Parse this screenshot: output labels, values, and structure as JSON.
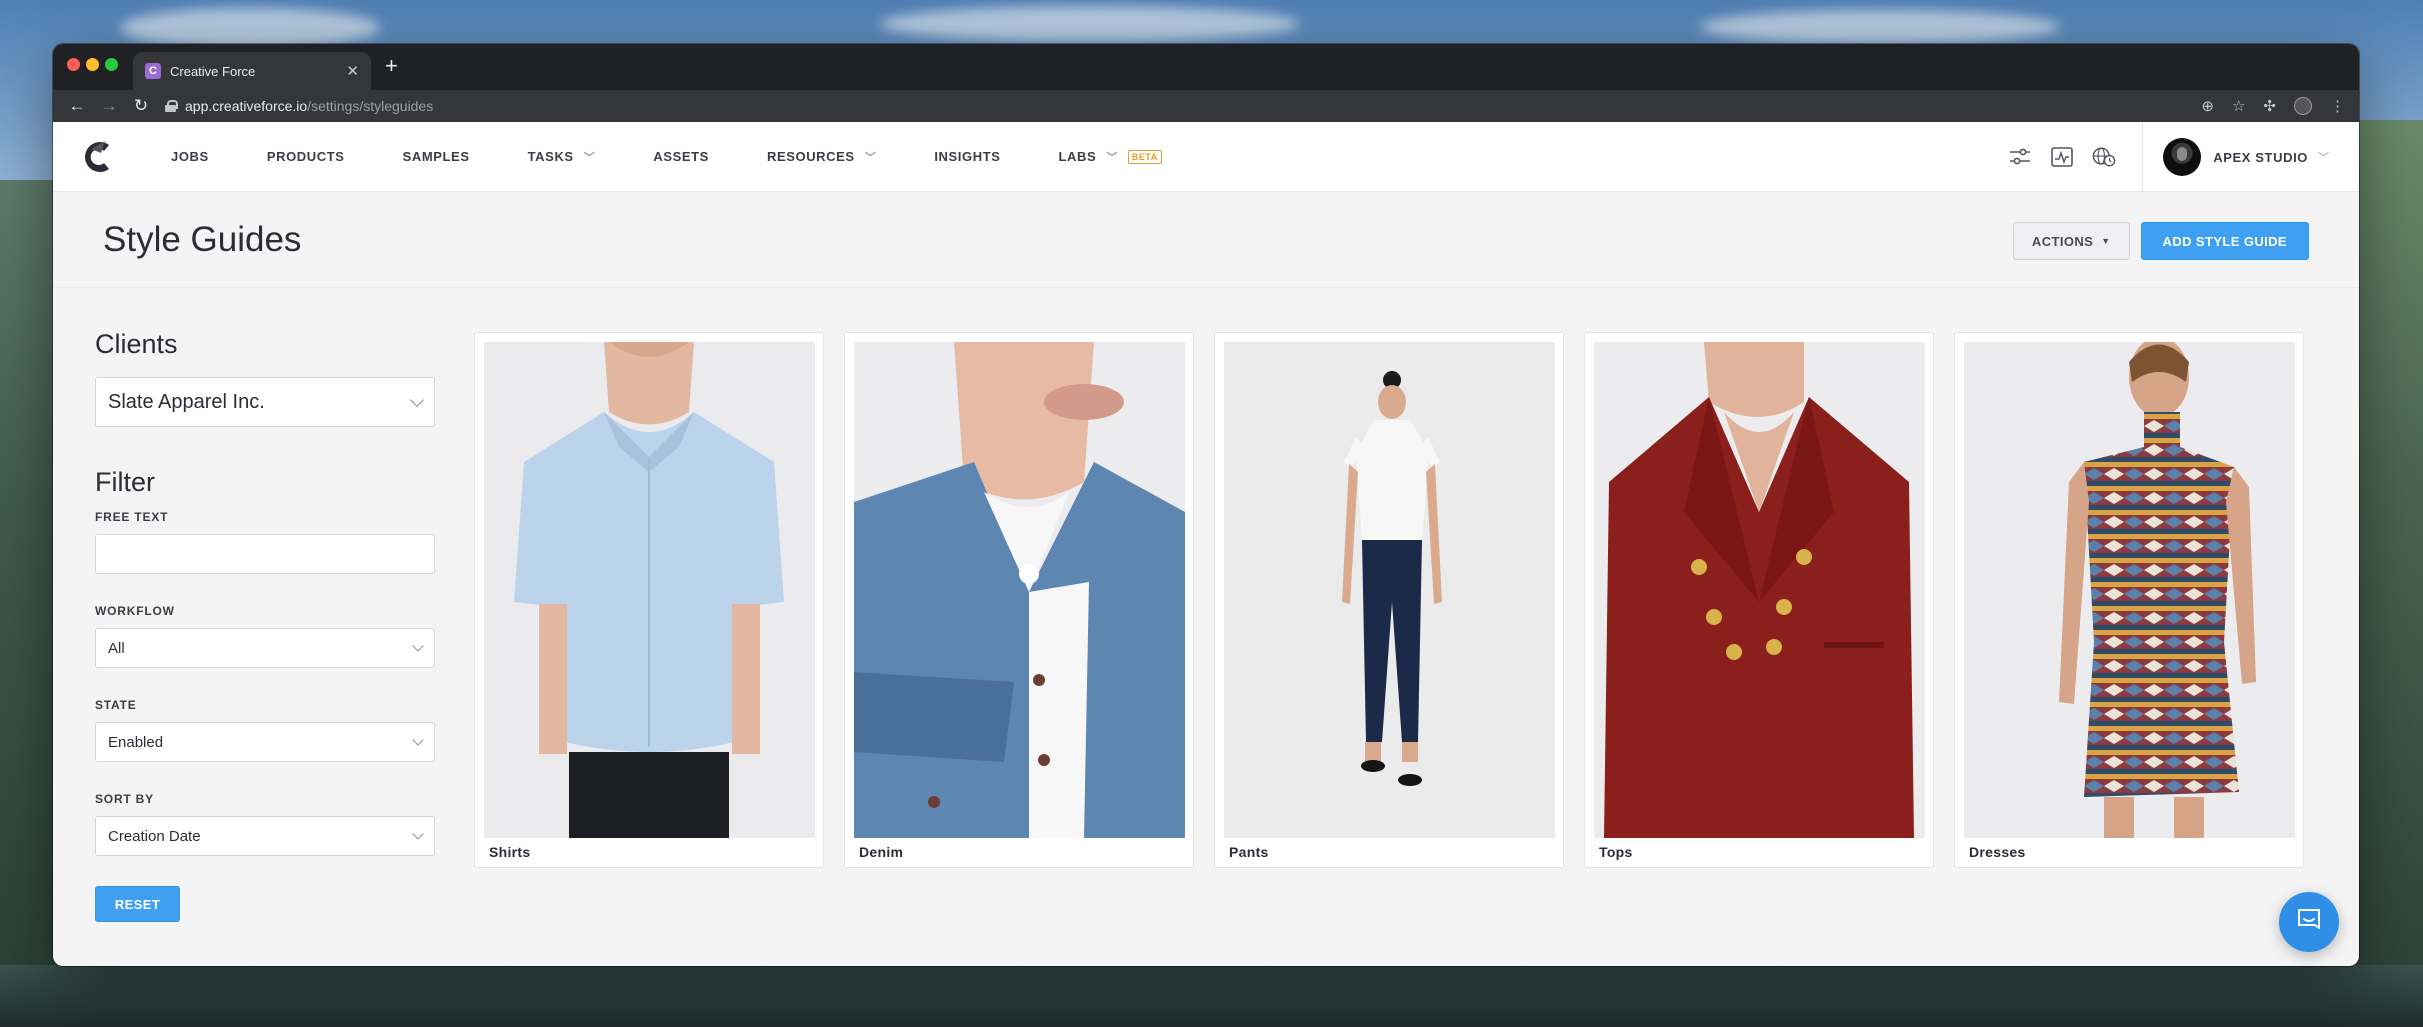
{
  "browser": {
    "tab_title": "Creative Force",
    "tab_favicon_letter": "C",
    "url_host": "app.creativeforce.io",
    "url_path": "/settings/styleguides"
  },
  "nav": {
    "items": [
      {
        "label": "JOBS",
        "has_dropdown": false
      },
      {
        "label": "PRODUCTS",
        "has_dropdown": false
      },
      {
        "label": "SAMPLES",
        "has_dropdown": false
      },
      {
        "label": "TASKS",
        "has_dropdown": true
      },
      {
        "label": "ASSETS",
        "has_dropdown": false
      },
      {
        "label": "RESOURCES",
        "has_dropdown": true
      },
      {
        "label": "INSIGHTS",
        "has_dropdown": false
      },
      {
        "label": "LABS",
        "has_dropdown": true
      }
    ],
    "beta_badge": "BETA",
    "account_name": "APEX STUDIO"
  },
  "page": {
    "title": "Style Guides",
    "actions_label": "ACTIONS",
    "add_label": "ADD STYLE GUIDE"
  },
  "sidebar": {
    "clients_heading": "Clients",
    "client_selected": "Slate Apparel Inc.",
    "filter_heading": "Filter",
    "free_text_label": "FREE TEXT",
    "free_text_value": "",
    "workflow_label": "WORKFLOW",
    "workflow_value": "All",
    "state_label": "STATE",
    "state_value": "Enabled",
    "sort_label": "SORT BY",
    "sort_value": "Creation Date",
    "reset_label": "RESET"
  },
  "cards": [
    {
      "label": "Shirts",
      "image": "model-light-blue-shirt"
    },
    {
      "label": "Denim",
      "image": "model-denim-jacket"
    },
    {
      "label": "Pants",
      "image": "model-dark-jeans-full-body"
    },
    {
      "label": "Tops",
      "image": "model-red-blazer"
    },
    {
      "label": "Dresses",
      "image": "model-patterned-knit-dress"
    }
  ],
  "colors": {
    "primary": "#3fa0f2",
    "beta": "#e59b2a",
    "chat": "#2f8fe6"
  }
}
